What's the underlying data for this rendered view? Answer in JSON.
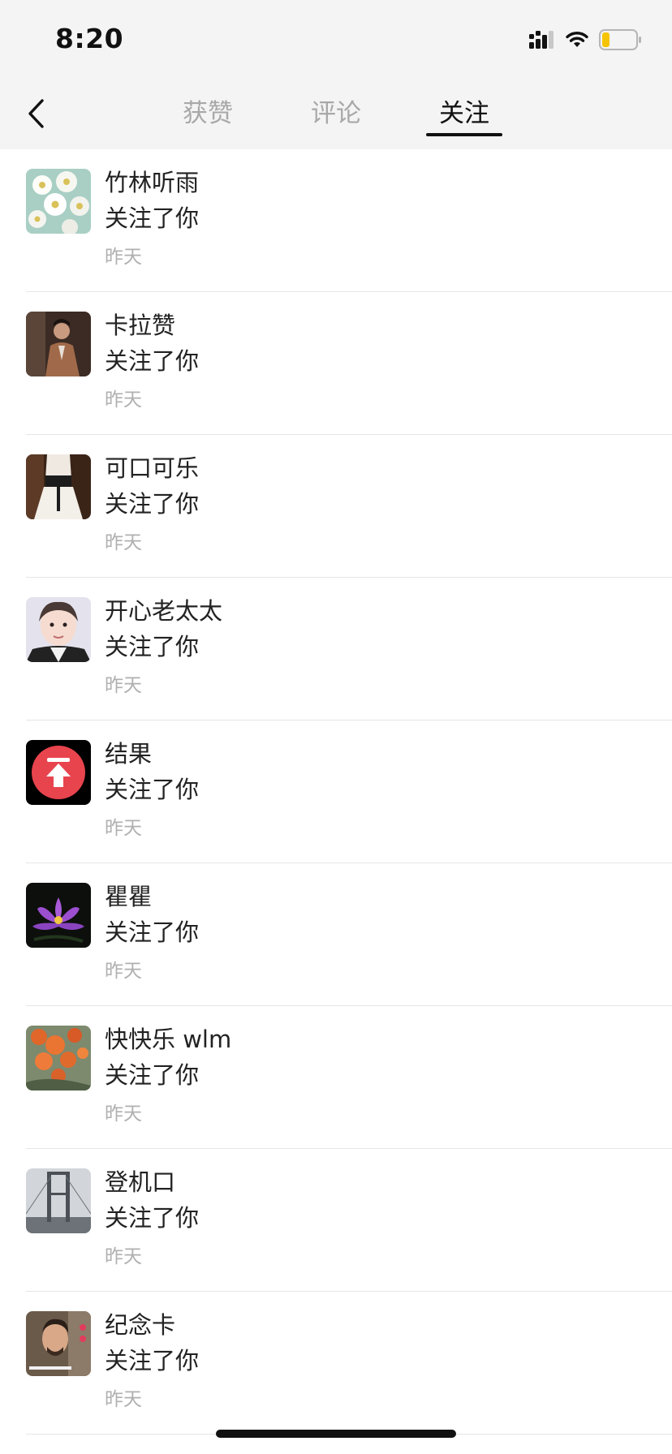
{
  "status_bar": {
    "time": "8:20",
    "signal_icon": "signal-bars-icon",
    "wifi_icon": "wifi-icon",
    "battery_icon": "battery-low-icon",
    "battery_color": "#f5c400"
  },
  "header": {
    "back_icon": "chevron-left-icon",
    "tabs": [
      {
        "label": "获赞",
        "active": false
      },
      {
        "label": "评论",
        "active": false
      },
      {
        "label": "关注",
        "active": true
      }
    ]
  },
  "notifications": [
    {
      "name": "竹林听雨",
      "action": "关注了你",
      "time": "昨天",
      "avatar": "white-daisies-photo"
    },
    {
      "name": "卡拉赞",
      "action": "关注了你",
      "time": "昨天",
      "avatar": "man-portrait-photo"
    },
    {
      "name": "可口可乐",
      "action": "关注了你",
      "time": "昨天",
      "avatar": "woman-dress-photo"
    },
    {
      "name": "开心老太太",
      "action": "关注了你",
      "time": "昨天",
      "avatar": "child-face-photo"
    },
    {
      "name": "结果",
      "action": "关注了你",
      "time": "昨天",
      "avatar": "red-upload-logo"
    },
    {
      "name": "瞿瞿",
      "action": "关注了你",
      "time": "昨天",
      "avatar": "purple-lotus-photo"
    },
    {
      "name": "快快乐 wlm",
      "action": "关注了你",
      "time": "昨天",
      "avatar": "orange-flowers-photo"
    },
    {
      "name": "登机口",
      "action": "关注了你",
      "time": "昨天",
      "avatar": "bridge-tower-photo"
    },
    {
      "name": "纪念卡",
      "action": "关注了你",
      "time": "昨天",
      "avatar": "man-video-photo"
    }
  ],
  "colors": {
    "header_background": "#f4f4f4",
    "active_tab": "#111111",
    "inactive_tab": "#a8a8a8",
    "timestamp": "#b0b0b0",
    "divider": "#e5e5e5"
  }
}
